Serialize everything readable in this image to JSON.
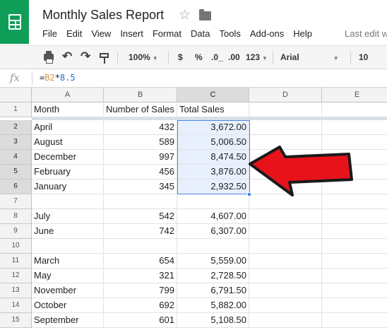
{
  "app": {
    "title": "Monthly Sales Report",
    "star_icon": "star-outline-icon",
    "folder_icon": "folder-icon"
  },
  "menu": [
    "File",
    "Edit",
    "View",
    "Insert",
    "Format",
    "Data",
    "Tools",
    "Add-ons",
    "Help"
  ],
  "last_edit": "Last edit w",
  "toolbar": {
    "zoom": "100%",
    "currency": "$",
    "percent": "%",
    "decrease_decimals": ".0_",
    "increase_decimals": ".00",
    "more_formats": "123",
    "font": "Arial",
    "font_size": "10"
  },
  "formula_bar": {
    "fx_label": "fx",
    "prefix": "=",
    "ref": "B2",
    "op": "*",
    "constant": "8.5"
  },
  "columns": [
    "A",
    "B",
    "C",
    "D",
    "E"
  ],
  "selected_column": "C",
  "selected_rows": [
    2,
    3,
    4,
    5,
    6
  ],
  "rows": [
    {
      "num": "1",
      "a": "Month",
      "b": "Number of Sales",
      "c": "Total Sales"
    },
    {
      "num": "2",
      "a": "April",
      "b": "432",
      "c": "3,672.00"
    },
    {
      "num": "3",
      "a": "August",
      "b": "589",
      "c": "5,006.50"
    },
    {
      "num": "4",
      "a": "December",
      "b": "997",
      "c": "8,474.50"
    },
    {
      "num": "5",
      "a": "February",
      "b": "456",
      "c": "3,876.00"
    },
    {
      "num": "6",
      "a": "January",
      "b": "345",
      "c": "2,932.50"
    },
    {
      "num": "7",
      "a": "",
      "b": "",
      "c": ""
    },
    {
      "num": "8",
      "a": "July",
      "b": "542",
      "c": "4,607.00"
    },
    {
      "num": "9",
      "a": "June",
      "b": "742",
      "c": "6,307.00"
    },
    {
      "num": "10",
      "a": "",
      "b": "",
      "c": ""
    },
    {
      "num": "11",
      "a": "March",
      "b": "654",
      "c": "5,559.00"
    },
    {
      "num": "12",
      "a": "May",
      "b": "321",
      "c": "2,728.50"
    },
    {
      "num": "13",
      "a": "November",
      "b": "799",
      "c": "6,791.50"
    },
    {
      "num": "14",
      "a": "October",
      "b": "692",
      "c": "5,882.00"
    },
    {
      "num": "15",
      "a": "September",
      "b": "601",
      "c": "5,108.50"
    }
  ],
  "colors": {
    "brand": "#0f9d58",
    "selection": "#4a86e8",
    "selection_fill": "#e8f0fe",
    "arrow": "#e8121b"
  }
}
